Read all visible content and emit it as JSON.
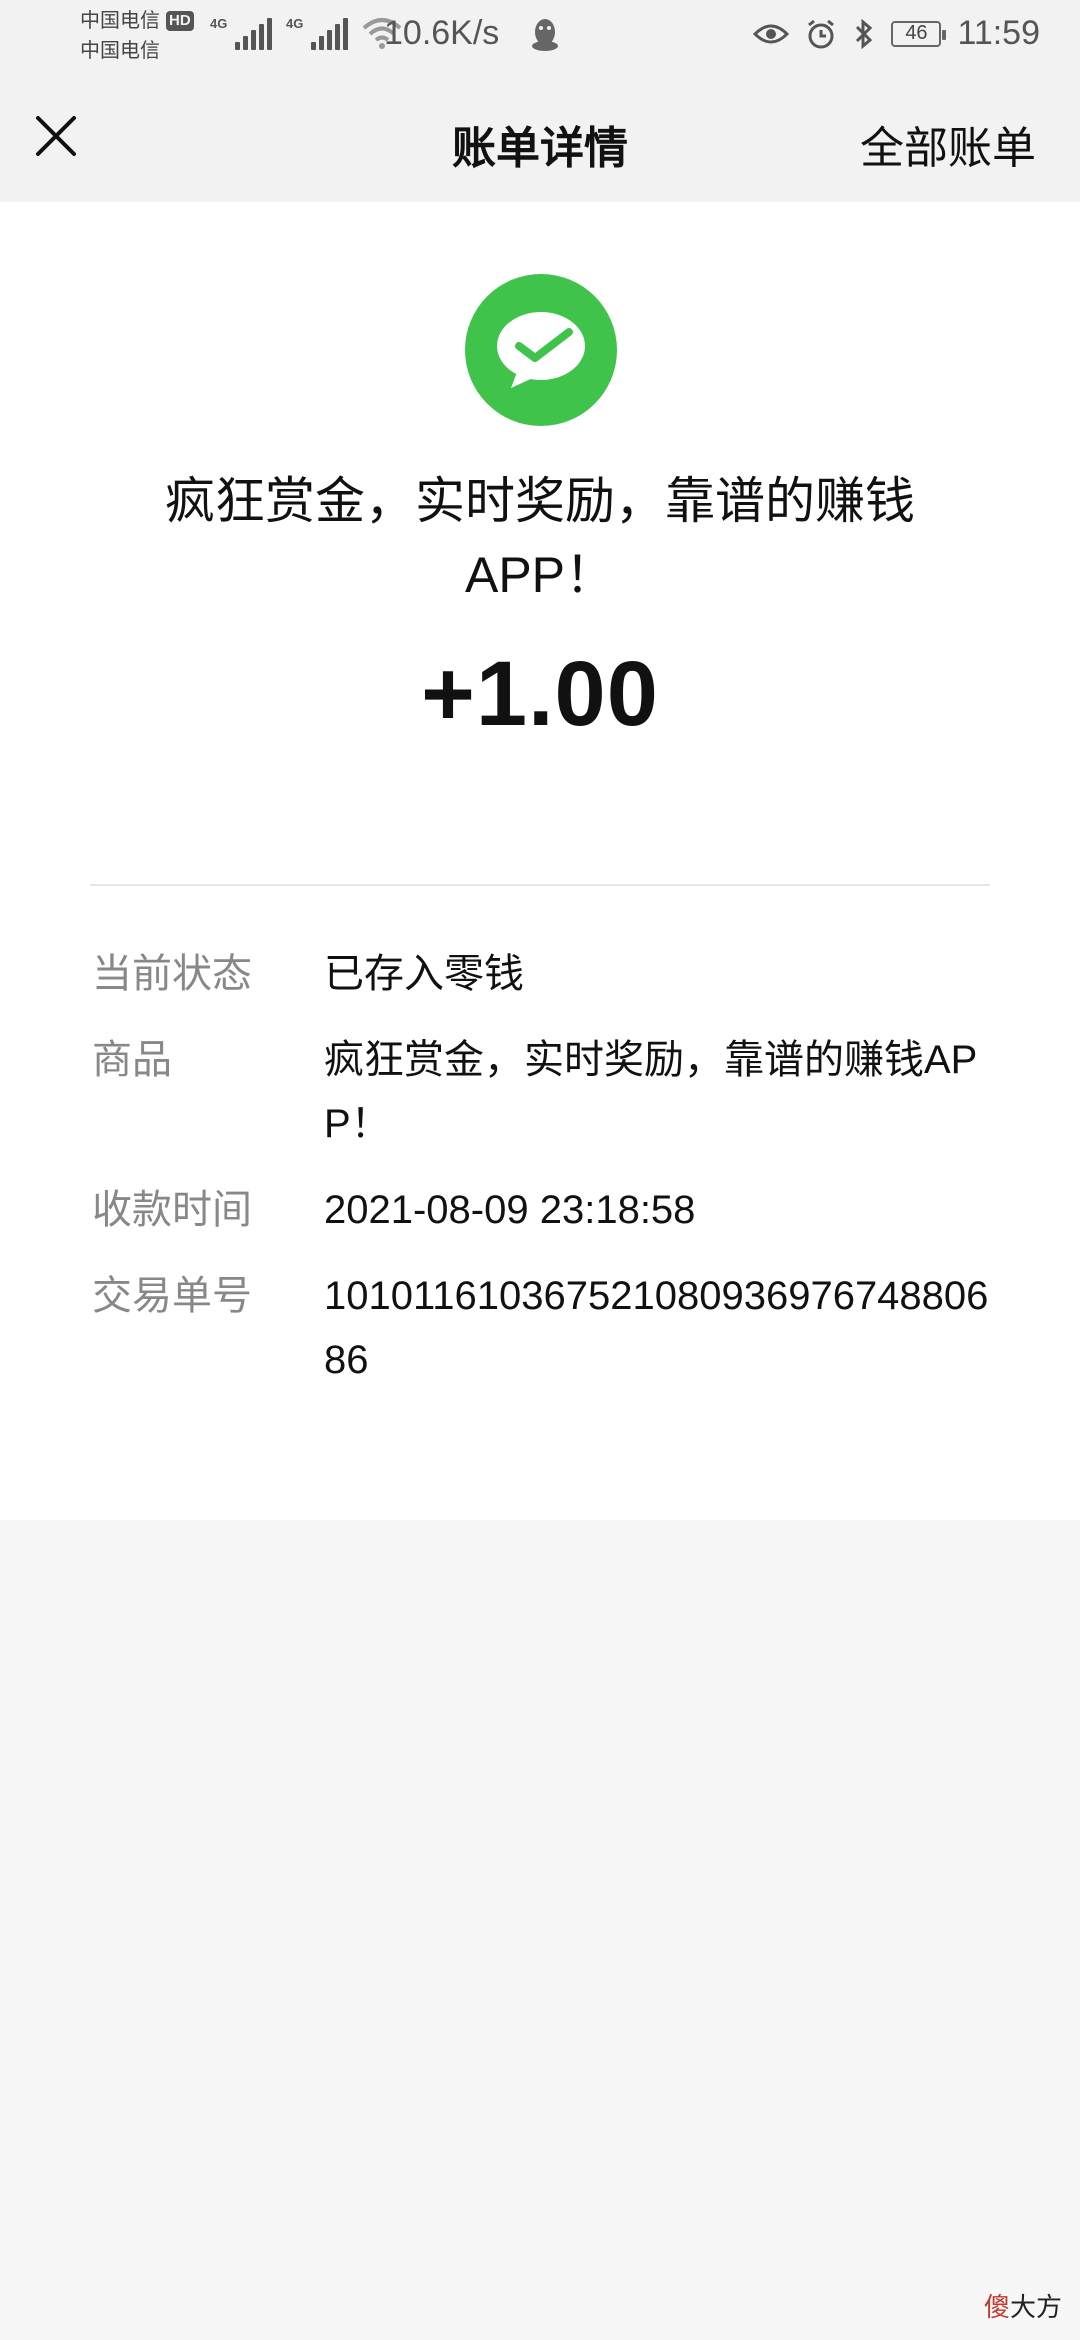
{
  "status_bar": {
    "carrier_1": "中国电信",
    "hd_badge": "HD",
    "carrier_2": "中国电信",
    "net_tag_1": "4G",
    "net_tag_2": "4G",
    "speed": "10.6K/s",
    "battery": "46",
    "time": "11:59"
  },
  "nav": {
    "title": "账单详情",
    "right_link": "全部账单"
  },
  "bill": {
    "headline": "疯狂赏金，实时奖励，靠谱的赚钱APP！",
    "amount": "+1.00",
    "logo_color": "#3fc34b"
  },
  "details": [
    {
      "label": "当前状态",
      "value": "已存入零钱"
    },
    {
      "label": "商品",
      "value": "疯狂赏金，实时奖励，靠谱的赚钱APP！"
    },
    {
      "label": "收款时间",
      "value": "2021-08-09 23:18:58"
    },
    {
      "label": "交易单号",
      "value": "10101161036752108093697674880686"
    }
  ],
  "watermark": {
    "red_part": "傻",
    "black_part": "大方"
  }
}
